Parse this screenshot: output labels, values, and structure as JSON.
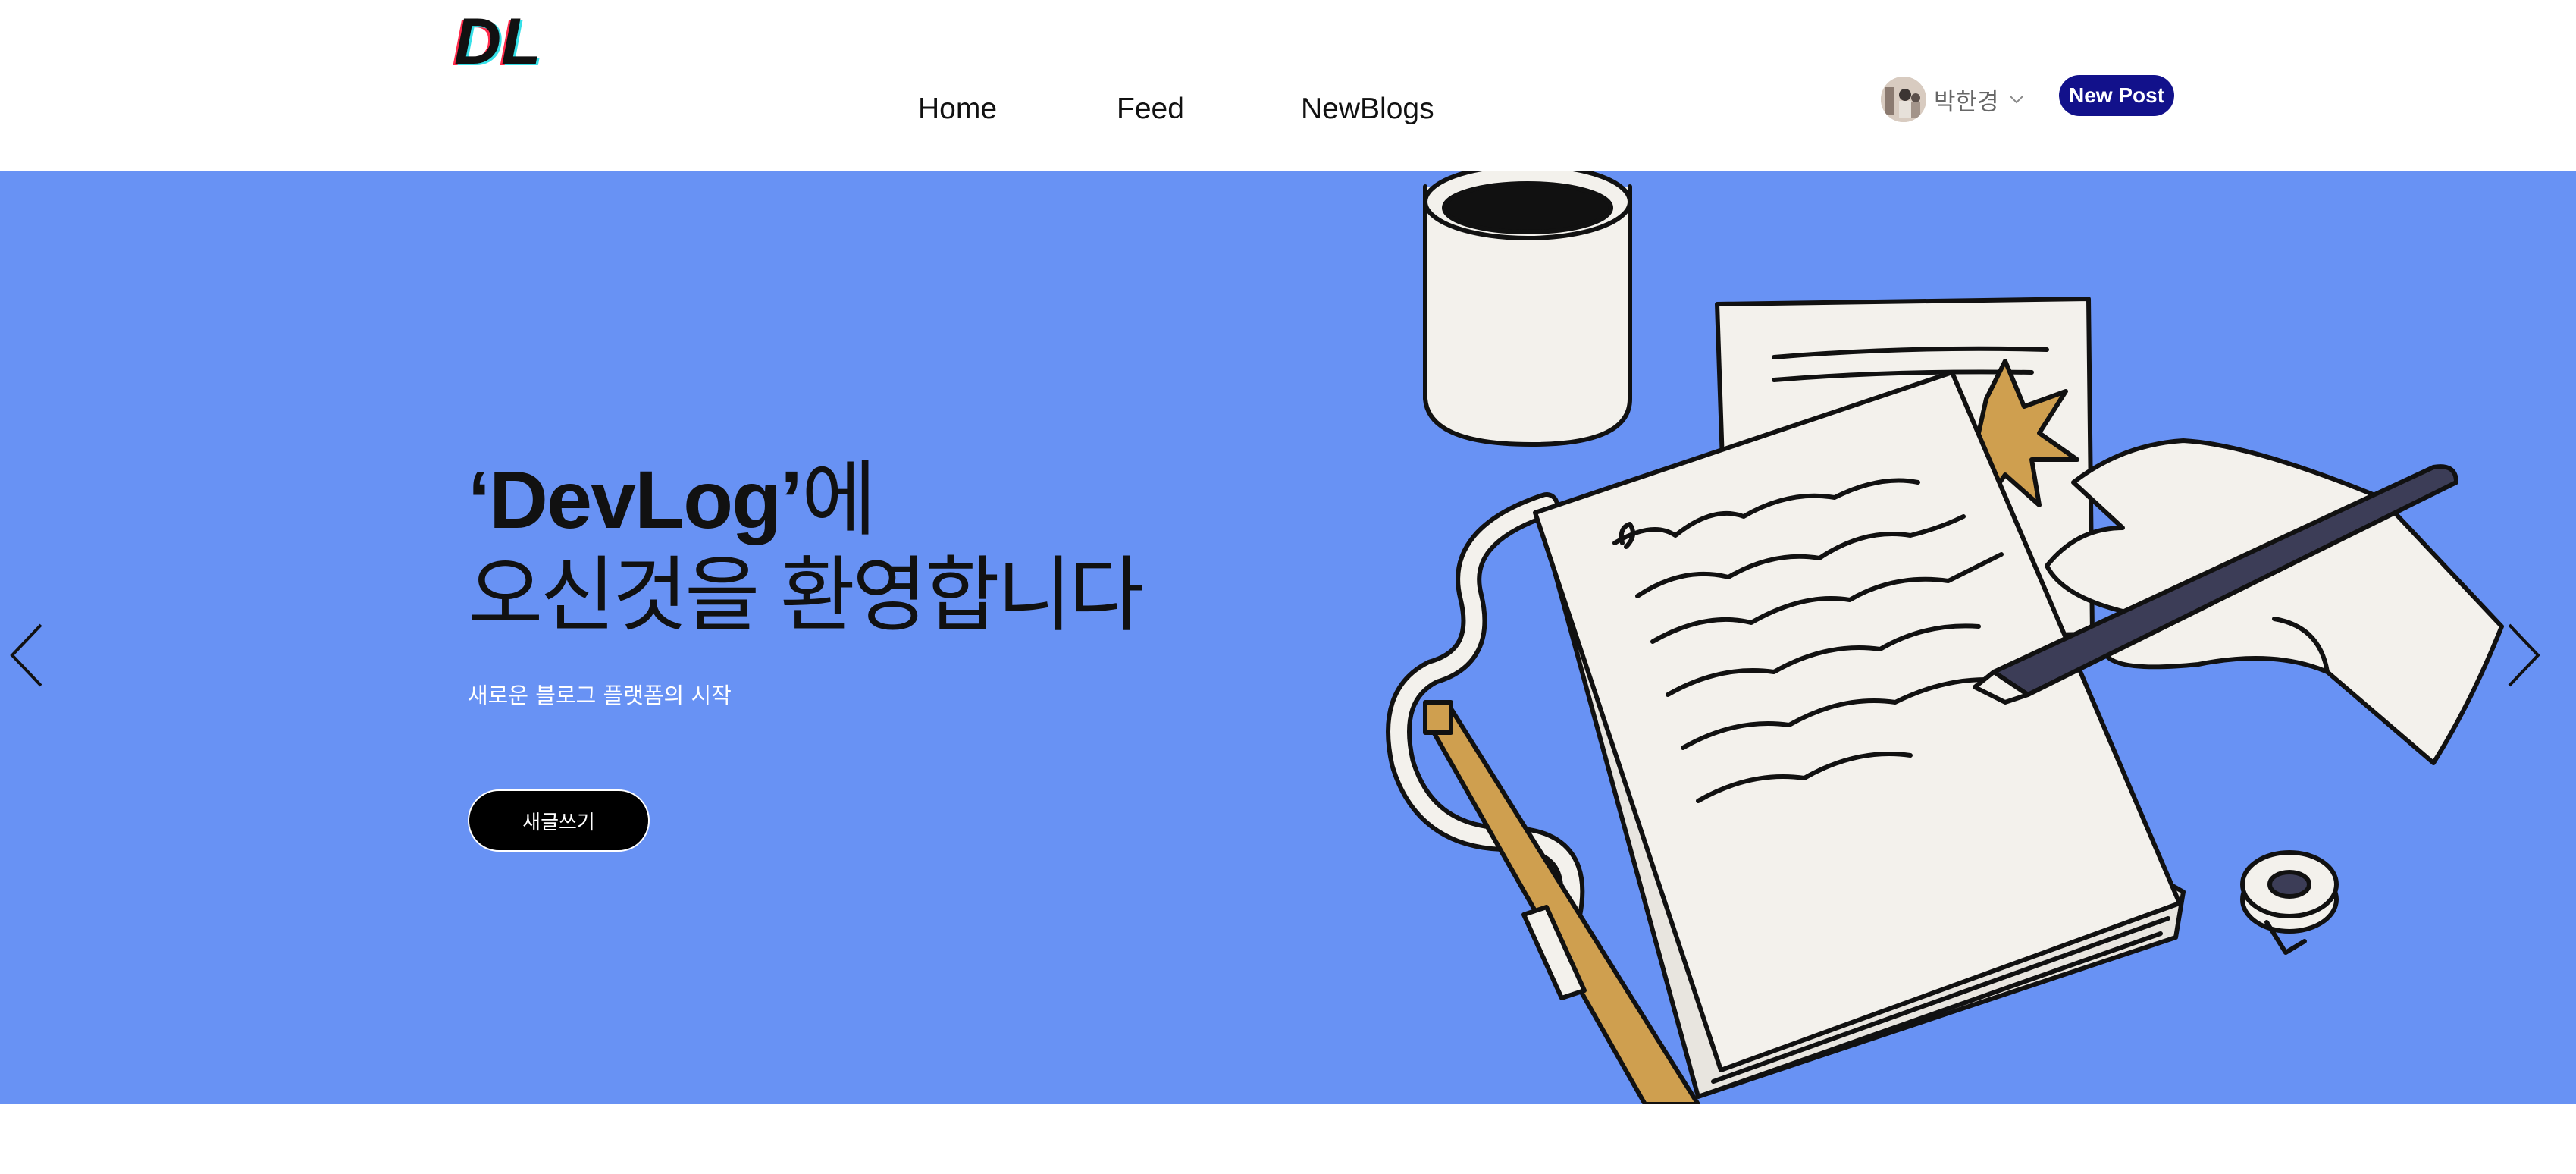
{
  "logo": {
    "text": "DL",
    "icon": "dl-logo"
  },
  "nav": {
    "items": [
      "Home",
      "Feed",
      "NewBlogs"
    ]
  },
  "user": {
    "name": "박한경",
    "avatar_icon": "user-avatar",
    "dropdown_icon": "chevron-down-icon"
  },
  "header": {
    "new_post_label": "New Post",
    "new_post_color": "#12118b"
  },
  "hero": {
    "title_quoted": "‘DevLog’",
    "title_suffix": "에",
    "title_line2": "오신것을 환영합니다",
    "subtitle": "새로운 블로그 플랫폼의 시작",
    "cta_label": "새글쓰기",
    "background_color": "#6892f4",
    "illustration_icon": "writing-notebook-illustration",
    "prev_icon": "chevron-left-icon",
    "next_icon": "chevron-right-icon"
  }
}
